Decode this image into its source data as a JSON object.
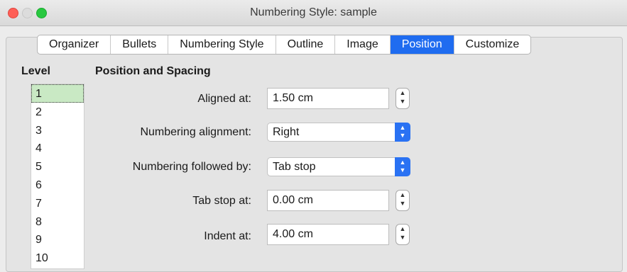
{
  "window": {
    "title": "Numbering Style: sample"
  },
  "tabs": [
    {
      "label": "Organizer",
      "selected": false
    },
    {
      "label": "Bullets",
      "selected": false
    },
    {
      "label": "Numbering Style",
      "selected": false
    },
    {
      "label": "Outline",
      "selected": false
    },
    {
      "label": "Image",
      "selected": false
    },
    {
      "label": "Position",
      "selected": true
    },
    {
      "label": "Customize",
      "selected": false
    }
  ],
  "level": {
    "title": "Level",
    "items": [
      "1",
      "2",
      "3",
      "4",
      "5",
      "6",
      "7",
      "8",
      "9",
      "10"
    ],
    "selected": "1"
  },
  "position": {
    "section_title": "Position and Spacing",
    "aligned_at": {
      "label": "Aligned at:",
      "value": "1.50 cm"
    },
    "numbering_alignment": {
      "label": "Numbering alignment:",
      "value": "Right"
    },
    "numbering_followed_by": {
      "label": "Numbering followed by:",
      "value": "Tab stop"
    },
    "tab_stop_at": {
      "label": "Tab stop at:",
      "value": "0.00 cm"
    },
    "indent_at": {
      "label": "Indent at:",
      "value": "4.00 cm"
    }
  },
  "colors": {
    "accent": "#1f6cf0",
    "selection": "#c9e9c4"
  }
}
